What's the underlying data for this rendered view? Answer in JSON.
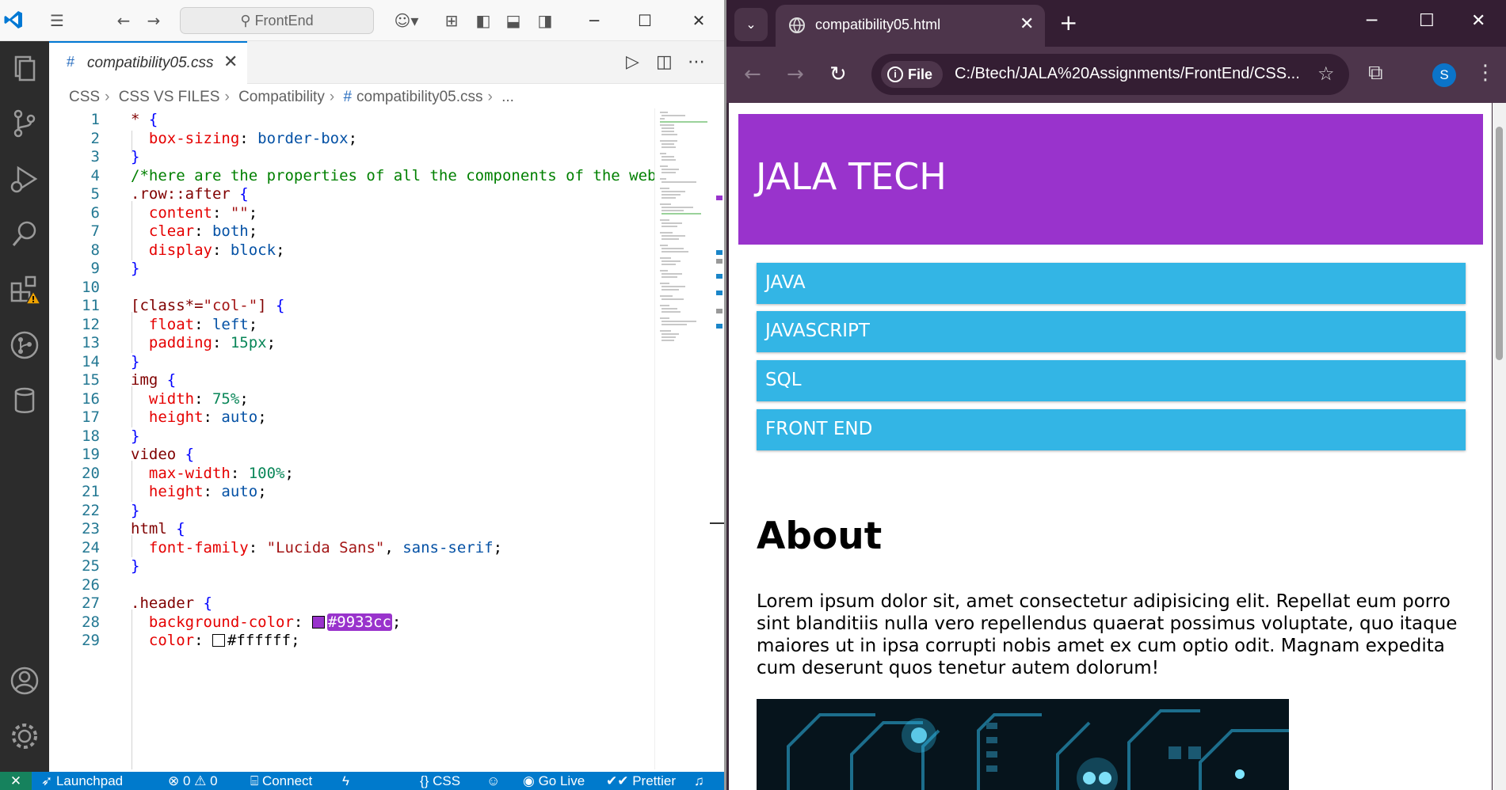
{
  "vscode": {
    "search_label": "FrontEnd",
    "tab": {
      "label": "compatibility05.css",
      "icon": "#"
    },
    "breadcrumb": [
      "CSS",
      "CSS VS FILES",
      "Compatibility",
      "compatibility05.css",
      "..."
    ],
    "status": {
      "launchpad": "Launchpad",
      "problems": "0",
      "warnings": "0",
      "connect": "Connect",
      "language": "CSS",
      "golive": "Go Live",
      "prettier": "Prettier"
    },
    "lines": [
      {
        "n": "1"
      },
      {
        "n": "2"
      },
      {
        "n": "3"
      },
      {
        "n": "4"
      },
      {
        "n": "5"
      },
      {
        "n": "6"
      },
      {
        "n": "7"
      },
      {
        "n": "8"
      },
      {
        "n": "9"
      },
      {
        "n": "10"
      },
      {
        "n": "11"
      },
      {
        "n": "12"
      },
      {
        "n": "13"
      },
      {
        "n": "14"
      },
      {
        "n": "15"
      },
      {
        "n": "16"
      },
      {
        "n": "17"
      },
      {
        "n": "18"
      },
      {
        "n": "19"
      },
      {
        "n": "20"
      },
      {
        "n": "21"
      },
      {
        "n": "22"
      },
      {
        "n": "23"
      },
      {
        "n": "24"
      },
      {
        "n": "25"
      },
      {
        "n": "26"
      },
      {
        "n": "27"
      },
      {
        "n": "28"
      },
      {
        "n": "29"
      }
    ],
    "code": {
      "l1_sel": "*",
      "l2_prop": "box-sizing",
      "l2_val": "border-box",
      "l4_comment": "/*here are the properties of all the components of the web",
      "l5_sel": ".row::after",
      "l6_prop": "content",
      "l6_val": "\"\"",
      "l7_prop": "clear",
      "l7_val": "both",
      "l8_prop": "display",
      "l8_val": "block",
      "l11_sel": "[class*=",
      "l11_str": "\"col-\"",
      "l12_prop": "float",
      "l12_val": "left",
      "l13_prop": "padding",
      "l13_val": "15px",
      "l15_sel": "img",
      "l16_prop": "width",
      "l16_val": "75%",
      "l17_prop": "height",
      "l17_val": "auto",
      "l19_sel": "video",
      "l20_prop": "max-width",
      "l20_val": "100%",
      "l21_prop": "height",
      "l21_val": "auto",
      "l23_sel": "html",
      "l24_prop": "font-family",
      "l24_str": "\"Lucida Sans\"",
      "l24_val": "sans-serif",
      "l27_sel": ".header",
      "l28_prop": "background-color",
      "l28_val": "#9933cc",
      "l29_prop": "color",
      "l29_val": "#ffffff"
    }
  },
  "browser": {
    "tab_title": "compatibility05.html",
    "chip_label": "File",
    "url": "C:/Btech/JALA%20Assignments/FrontEnd/CSS...",
    "avatar_letter": "S"
  },
  "page": {
    "header_title": "JALA TECH",
    "menu": [
      "JAVA",
      "JAVASCRIPT",
      "SQL",
      "FRONT END"
    ],
    "about_heading": "About",
    "about_text": "Lorem ipsum dolor sit, amet consectetur adipisicing elit. Repellat eum porro sint blanditiis nulla vero repellendus quaerat possimus voluptate, quo itaque maiores ut in ipsa corrupti nobis amet ex cum optio odit. Magnam expedita cum deserunt quos tenetur autem dolorum!"
  },
  "colors": {
    "header_bg": "#9933cc",
    "menu_bg": "#33b5e5",
    "vscode_accent": "#007acc",
    "browser_frame": "#4d354b"
  }
}
